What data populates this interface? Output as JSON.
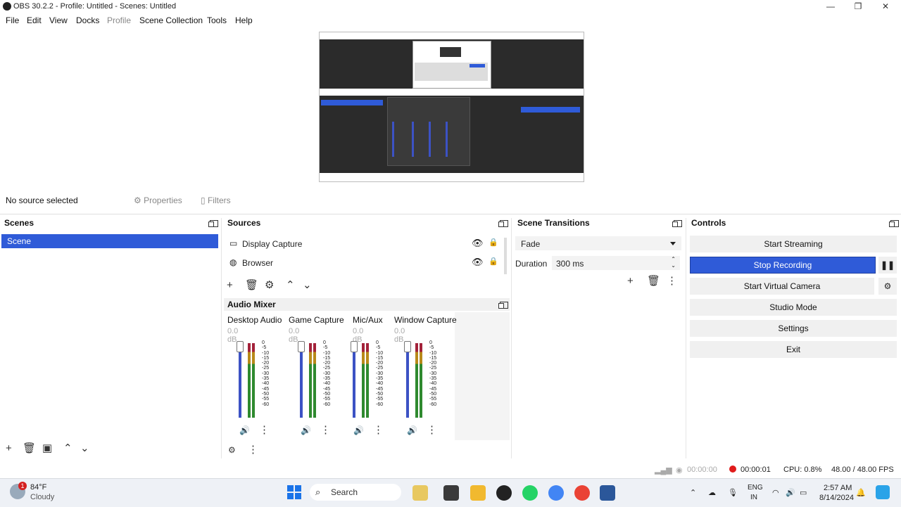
{
  "window": {
    "title": "OBS 30.2.2 - Profile: Untitled - Scenes: Untitled",
    "min": "—",
    "restore": "❐",
    "close": "✕"
  },
  "menu": {
    "file": "File",
    "edit": "Edit",
    "view": "View",
    "docks": "Docks",
    "profile": "Profile",
    "scene_collection": "Scene Collection",
    "tools": "Tools",
    "help": "Help"
  },
  "source_bar": {
    "status": "No source selected",
    "properties": "Properties",
    "filters": "Filters"
  },
  "scenes": {
    "title": "Scenes",
    "items": [
      "Scene"
    ]
  },
  "sources": {
    "title": "Sources",
    "items": [
      {
        "label": "Display Capture"
      },
      {
        "label": "Browser"
      }
    ]
  },
  "transitions": {
    "title": "Scene Transitions",
    "selected": "Fade",
    "duration_label": "Duration",
    "duration_value": "300 ms"
  },
  "controls": {
    "title": "Controls",
    "start_streaming": "Start Streaming",
    "stop_recording": "Stop Recording",
    "start_virtual_camera": "Start Virtual Camera",
    "studio_mode": "Studio Mode",
    "settings": "Settings",
    "exit": "Exit"
  },
  "audio_mixer": {
    "title": "Audio Mixer",
    "channels": [
      {
        "name": "Desktop Audio",
        "db": "0.0 dB"
      },
      {
        "name": "Game Capture",
        "db": "0.0 dB"
      },
      {
        "name": "Mic/Aux",
        "db": "0.0 dB"
      },
      {
        "name": "Window Capture",
        "db": "0.0 dB"
      }
    ],
    "scale": [
      "0",
      "-5",
      "-10",
      "-15",
      "-20",
      "-25",
      "-30",
      "-35",
      "-40",
      "-45",
      "-50",
      "-55",
      "-60"
    ]
  },
  "status": {
    "stream_time": "00:00:00",
    "rec_time": "00:00:01",
    "cpu": "CPU: 0.8%",
    "fps": "48.00 / 48.00 FPS"
  },
  "taskbar": {
    "weather_temp": "84°F",
    "weather_desc": "Cloudy",
    "weather_badge": "1",
    "search": "Search",
    "lang_top": "ENG",
    "lang_bottom": "IN",
    "time": "2:57 AM",
    "date": "8/14/2024"
  },
  "colors": {
    "accent": "#2f5bd8",
    "record": "#e01b1b"
  }
}
